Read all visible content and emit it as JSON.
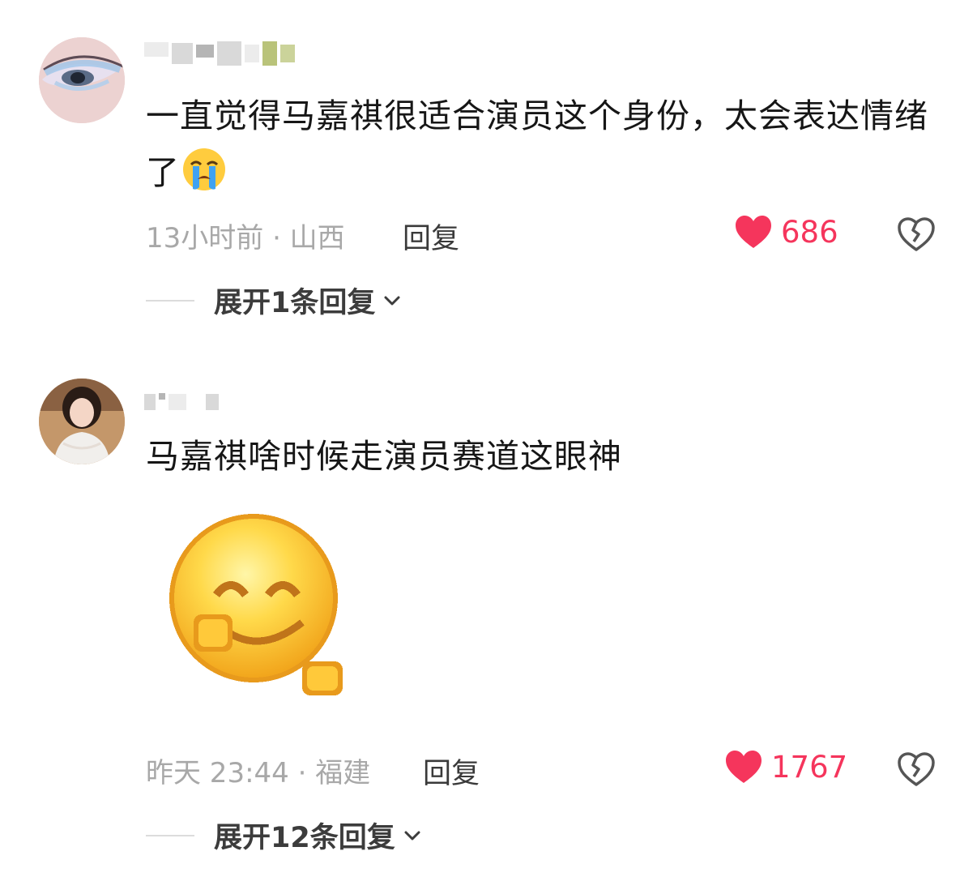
{
  "comments": [
    {
      "text": "一直觉得马嘉祺很适合演员这个身份，太会表达情绪了",
      "inline_emoji": "crying-face",
      "time_location": "13小时前 · 山西",
      "reply_label": "回复",
      "likes": "686",
      "expand_label": "展开1条回复"
    },
    {
      "text": "马嘉祺啥时候走演员赛道这眼神",
      "sticker": "pixel-smiley-sticker",
      "time_location": "昨天 23:44 · 福建",
      "reply_label": "回复",
      "likes": "1767",
      "expand_label": "展开12条回复"
    }
  ],
  "colors": {
    "like": "#f5355c",
    "meta": "#a8a8a8",
    "text": "#161616"
  }
}
